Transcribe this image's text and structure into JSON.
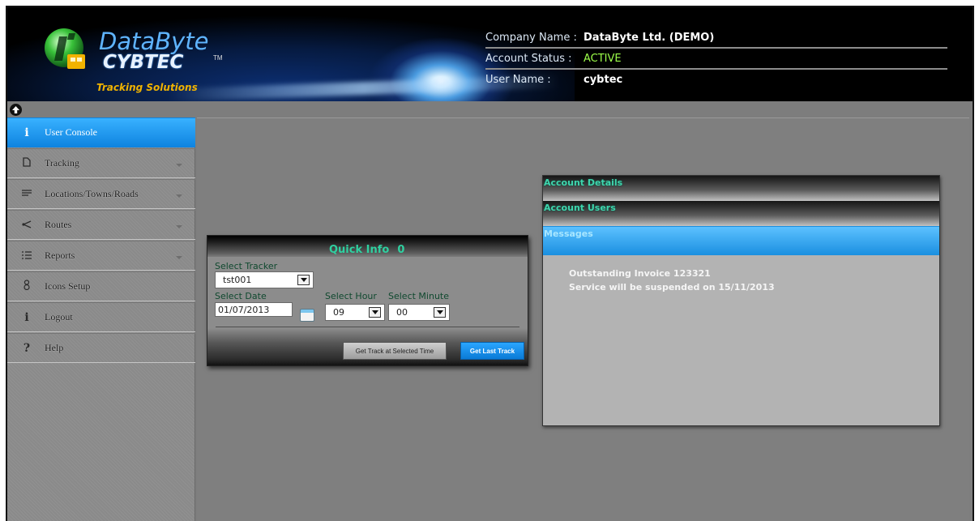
{
  "brand": {
    "name_line1": "DataByte",
    "name_line2": "CYBTEC",
    "trademark": "TM",
    "tagline": "Tracking Solutions"
  },
  "account": {
    "company_label": "Company Name :",
    "company_value": "DataByte Ltd. (DEMO)",
    "status_label": "Account Status :",
    "status_value": "ACTIVE",
    "user_label": "User Name :",
    "user_value": "cybtec"
  },
  "colors": {
    "active_blue": "#1b92ea",
    "status_green": "#9dff4a",
    "heading_teal": "#2fd0a0"
  },
  "sidebar": {
    "items": [
      {
        "label": "User Console",
        "icon": "info-icon",
        "active": true,
        "has_dropdown": false
      },
      {
        "label": "Tracking",
        "icon": "document-icon",
        "active": false,
        "has_dropdown": true
      },
      {
        "label": "Locations/Towns/Roads",
        "icon": "lines-icon",
        "active": false,
        "has_dropdown": true
      },
      {
        "label": "Routes",
        "icon": "share-icon",
        "active": false,
        "has_dropdown": true
      },
      {
        "label": "Reports",
        "icon": "list-icon",
        "active": false,
        "has_dropdown": true
      },
      {
        "label": "Icons Setup",
        "icon": "user-icon",
        "active": false,
        "has_dropdown": false
      },
      {
        "label": "Logout",
        "icon": "info-icon",
        "active": false,
        "has_dropdown": false
      },
      {
        "label": "Help",
        "icon": "question-icon",
        "active": false,
        "has_dropdown": false
      }
    ]
  },
  "quick_info": {
    "title": "Quick Info",
    "count": "0",
    "tracker_label": "Select Tracker",
    "tracker_value": "tst001",
    "date_label": "Select Date",
    "date_value": "01/07/2013",
    "hour_label": "Select Hour",
    "hour_value": "09",
    "minute_label": "Select Minute",
    "minute_value": "00",
    "btn_selected_time": "Get Track at Selected Time",
    "btn_last_track": "Get Last Track"
  },
  "accordion": {
    "details_label": "Account Details",
    "users_label": "Account Users",
    "messages_label": "Messages",
    "messages": [
      "Outstanding Invoice 123321",
      "Service will be suspended on 15/11/2013"
    ]
  }
}
